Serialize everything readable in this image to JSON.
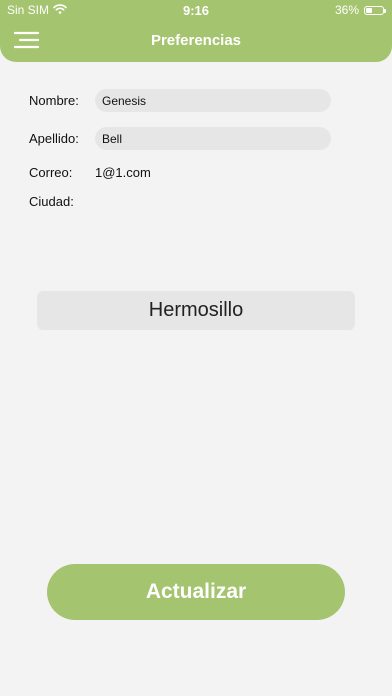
{
  "status_bar": {
    "carrier": "Sin SIM",
    "time": "9:16",
    "battery_percent": "36%",
    "battery_level": 0.36,
    "wifi_icon": "wifi-icon",
    "battery_icon": "battery-icon"
  },
  "nav": {
    "menu_icon": "hamburger-menu-icon",
    "title": "Preferencias"
  },
  "form": {
    "nombre_label": "Nombre:",
    "nombre_value": "Genesis",
    "apellido_label": "Apellido:",
    "apellido_value": "Bell",
    "correo_label": "Correo:",
    "correo_value": "1@1.com",
    "ciudad_label": "Ciudad:",
    "ciudad_value": "Hermosillo"
  },
  "actions": {
    "update_label": "Actualizar"
  },
  "colors": {
    "accent": "#a4c46f",
    "background": "#f3f3f3",
    "field": "#e6e6e6"
  }
}
